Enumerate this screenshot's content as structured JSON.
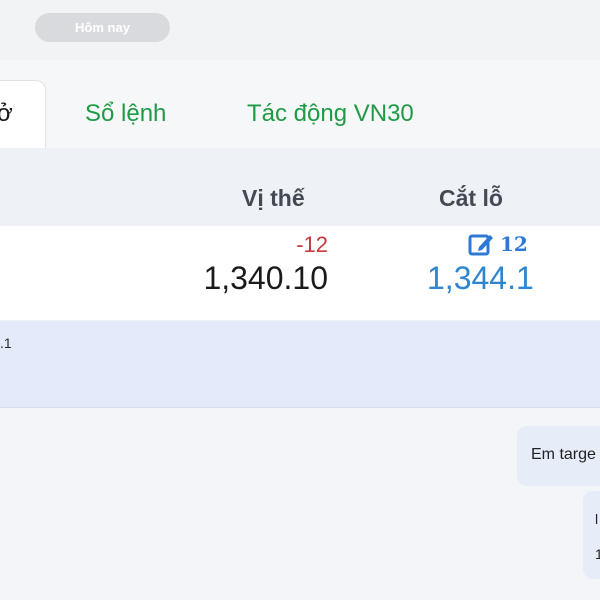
{
  "top_bar": {
    "today_label": "Hôm nay"
  },
  "tabs": [
    {
      "label": "ở",
      "active": true
    },
    {
      "label": "Sổ lệnh",
      "active": false
    },
    {
      "label": "Tác động VN30",
      "active": false
    }
  ],
  "table": {
    "headers": {
      "position": "Vị thế",
      "stop_loss": "Cắt lỗ"
    },
    "row": {
      "change": "-12",
      "position_value": "1,340.10",
      "stop_offset": "12",
      "stop_value": "1,344.1"
    }
  },
  "info_row": {
    "text": ".1"
  },
  "chat": {
    "bubble1": "Em targe",
    "bubble2_line1": "l",
    "bubble2_line2": "1"
  },
  "icons": {
    "edit": "edit-icon"
  },
  "colors": {
    "green_tab": "#1f9a45",
    "negative": "#c9383b",
    "link_blue": "#2e86d1"
  }
}
